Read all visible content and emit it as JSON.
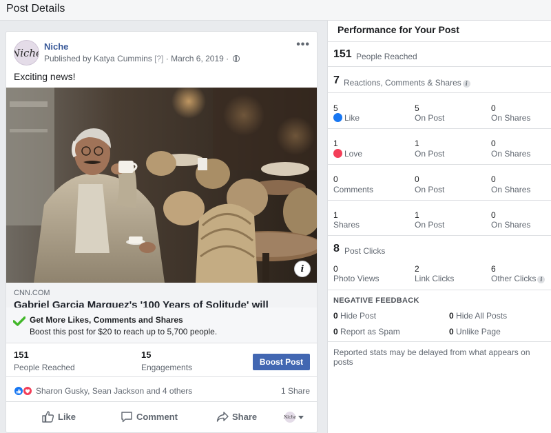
{
  "header": {
    "title": "Post Details"
  },
  "post": {
    "page_name": "Niche",
    "avatar_text": "Niche",
    "published_by": "Published by Katya Cummins",
    "question_mark": "[?]",
    "sep1": " · ",
    "date": "March 6, 2019",
    "sep2": " · ",
    "more_label": "•••",
    "text": "Exciting news!",
    "link": {
      "domain": "CNN.COM",
      "title": "Gabriel Garcia Marquez's '100 Years of Solitude' will become a Netflix series"
    },
    "info_label": "i",
    "promo": {
      "title": "Get More Likes, Comments and Shares",
      "subtitle": "Boost this post for $20 to reach up to 5,700 people."
    },
    "stats": {
      "reached_num": "151",
      "reached_label": "People Reached",
      "engagements_num": "15",
      "engagements_label": "Engagements",
      "boost_label": "Boost Post"
    },
    "reactions": {
      "names": "Sharon Gusky, Sean Jackson and 4 others",
      "shares": "1 Share"
    },
    "actions": {
      "like": "Like",
      "comment": "Comment",
      "share": "Share",
      "avatar_text": "Niche"
    }
  },
  "performance": {
    "title": "Performance for Your Post",
    "people_reached_num": "151",
    "people_reached_label": "People Reached",
    "rcs_num": "7",
    "rcs_label": "Reactions, Comments & Shares",
    "rows": [
      {
        "a_num": "5",
        "a_label": "Like",
        "b_num": "5",
        "b_label": "On Post",
        "c_num": "0",
        "c_label": "On Shares"
      },
      {
        "a_num": "1",
        "a_label": "Love",
        "b_num": "1",
        "b_label": "On Post",
        "c_num": "0",
        "c_label": "On Shares"
      },
      {
        "a_num": "0",
        "a_label": "Comments",
        "b_num": "0",
        "b_label": "On Post",
        "c_num": "0",
        "c_label": "On Shares"
      },
      {
        "a_num": "1",
        "a_label": "Shares",
        "b_num": "1",
        "b_label": "On Post",
        "c_num": "0",
        "c_label": "On Shares"
      }
    ],
    "clicks_num": "8",
    "clicks_label": "Post Clicks",
    "clicks": [
      {
        "num": "0",
        "label": "Photo Views"
      },
      {
        "num": "2",
        "label": "Link Clicks"
      },
      {
        "num": "6",
        "label": "Other Clicks"
      }
    ],
    "negative": {
      "title": "NEGATIVE FEEDBACK",
      "hide_post_num": "0",
      "hide_post_label": "Hide Post",
      "hide_all_num": "0",
      "hide_all_label": "Hide All Posts",
      "spam_num": "0",
      "spam_label": "Report as Spam",
      "unlike_num": "0",
      "unlike_label": "Unlike Page"
    },
    "footer": "Reported stats may be delayed from what appears on posts"
  }
}
